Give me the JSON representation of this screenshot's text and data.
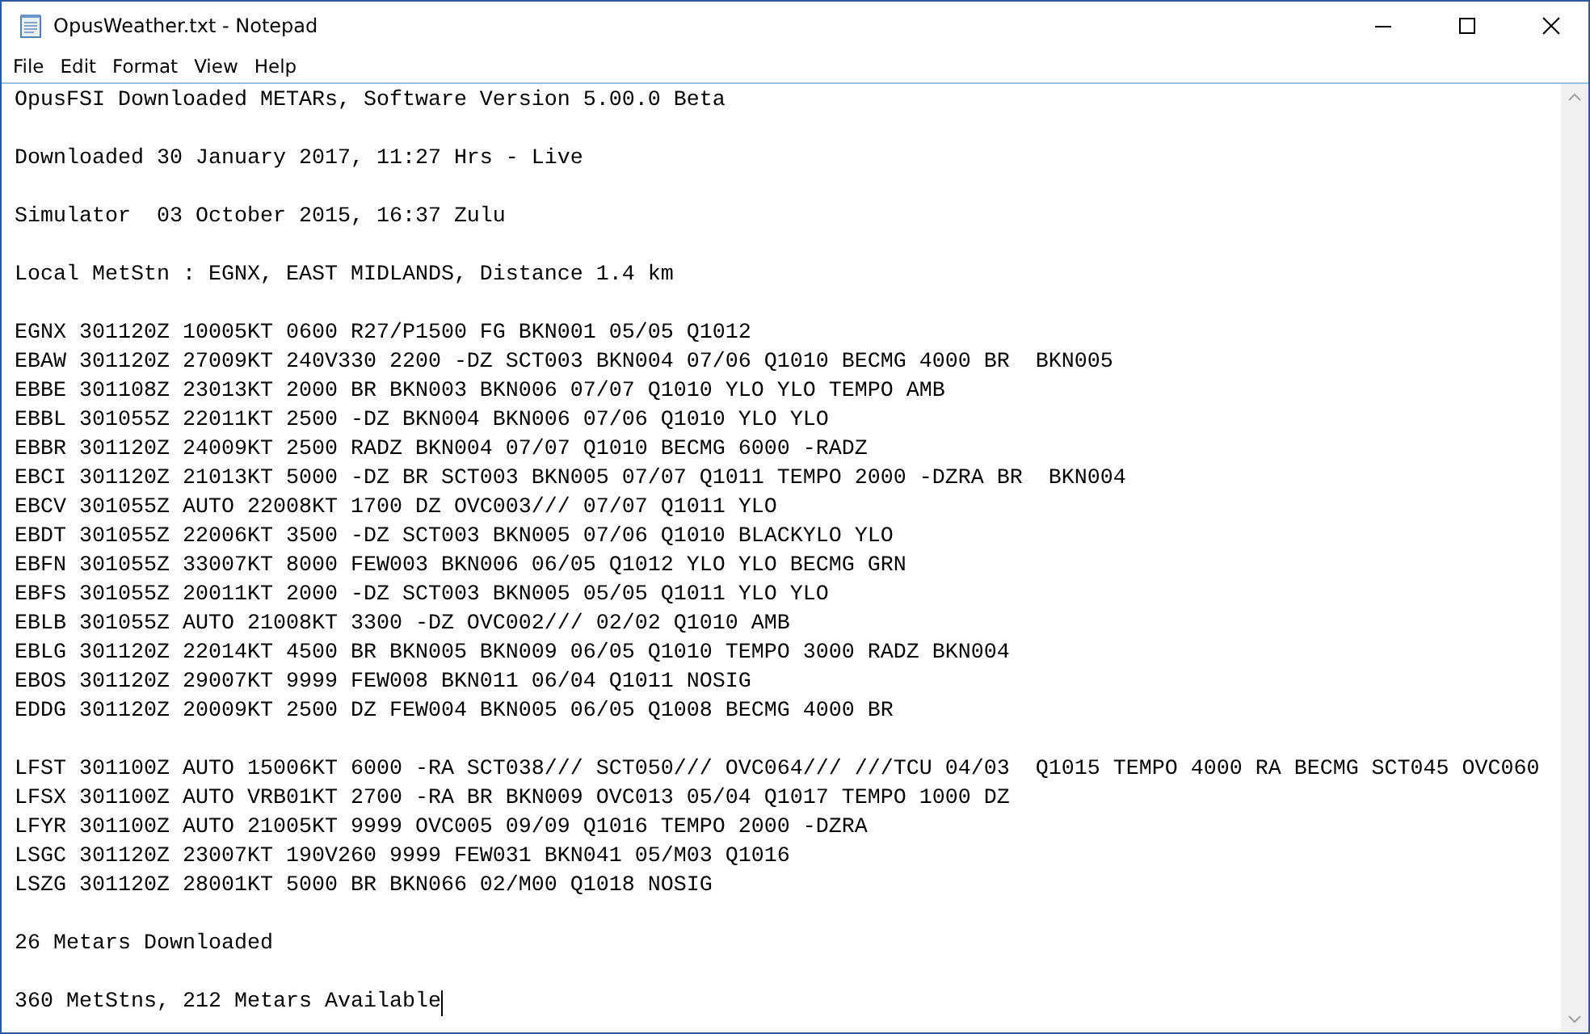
{
  "window": {
    "title": "OpusWeather.txt - Notepad"
  },
  "menu": [
    "File",
    "Edit",
    "Format",
    "View",
    "Help"
  ],
  "document": {
    "blocks": [
      [
        "OpusFSI Downloaded METARs, Software Version 5.00.0 Beta"
      ],
      [
        "Downloaded 30 January 2017, 11:27 Hrs - Live"
      ],
      [
        "Simulator  03 October 2015, 16:37 Zulu"
      ],
      [
        "Local MetStn : EGNX, EAST MIDLANDS, Distance 1.4 km"
      ],
      [
        "EGNX 301120Z 10005KT 0600 R27/P1500 FG BKN001 05/05 Q1012",
        "EBAW 301120Z 27009KT 240V330 2200 -DZ SCT003 BKN004 07/06 Q1010 BECMG 4000 BR  BKN005",
        "EBBE 301108Z 23013KT 2000 BR BKN003 BKN006 07/07 Q1010 YLO YLO TEMPO AMB",
        "EBBL 301055Z 22011KT 2500 -DZ BKN004 BKN006 07/06 Q1010 YLO YLO",
        "EBBR 301120Z 24009KT 2500 RADZ BKN004 07/07 Q1010 BECMG 6000 -RADZ",
        "EBCI 301120Z 21013KT 5000 -DZ BR SCT003 BKN005 07/07 Q1011 TEMPO 2000 -DZRA BR  BKN004",
        "EBCV 301055Z AUTO 22008KT 1700 DZ OVC003/// 07/07 Q1011 YLO",
        "EBDT 301055Z 22006KT 3500 -DZ SCT003 BKN005 07/06 Q1010 BLACKYLO YLO",
        "EBFN 301055Z 33007KT 8000 FEW003 BKN006 06/05 Q1012 YLO YLO BECMG GRN",
        "EBFS 301055Z 20011KT 2000 -DZ SCT003 BKN005 05/05 Q1011 YLO YLO",
        "EBLB 301055Z AUTO 21008KT 3300 -DZ OVC002/// 02/02 Q1010 AMB",
        "EBLG 301120Z 22014KT 4500 BR BKN005 BKN009 06/05 Q1010 TEMPO 3000 RADZ BKN004",
        "EBOS 301120Z 29007KT 9999 FEW008 BKN011 06/04 Q1011 NOSIG",
        "EDDG 301120Z 20009KT 2500 DZ FEW004 BKN005 06/05 Q1008 BECMG 4000 BR"
      ],
      [
        "LFST 301100Z AUTO 15006KT 6000 -RA SCT038/// SCT050/// OVC064/// ///TCU 04/03  Q1015 TEMPO 4000 RA BECMG SCT045 OVC060",
        "LFSX 301100Z AUTO VRB01KT 2700 -RA BR BKN009 OVC013 05/04 Q1017 TEMPO 1000 DZ",
        "LFYR 301100Z AUTO 21005KT 9999 OVC005 09/09 Q1016 TEMPO 2000 -DZRA",
        "LSGC 301120Z 23007KT 190V260 9999 FEW031 BKN041 05/M03 Q1016",
        "LSZG 301120Z 28001KT 5000 BR BKN066 02/M00 Q1018 NOSIG"
      ],
      [
        "26 Metars Downloaded"
      ],
      [
        "360 MetStns, 212 Metars Available"
      ]
    ]
  }
}
